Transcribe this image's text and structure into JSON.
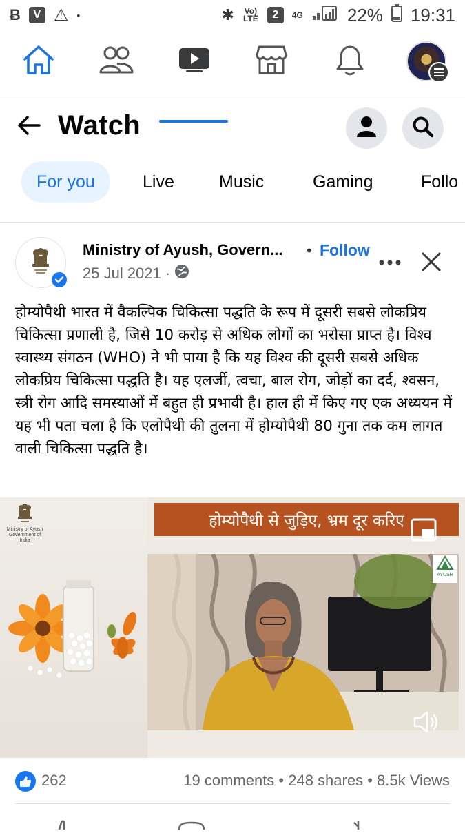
{
  "status_bar": {
    "network_label": "Vo) LTE",
    "sim_label": "2",
    "data_label": "4G",
    "battery": "22%",
    "time": "19:31"
  },
  "nav": {
    "items": [
      "home-icon",
      "friends-icon",
      "watch-icon",
      "marketplace-icon",
      "notifications-icon",
      "profile-menu"
    ],
    "active": "watch-icon"
  },
  "header": {
    "title": "Watch"
  },
  "tabs": [
    {
      "label": "For you",
      "active": true
    },
    {
      "label": "Live"
    },
    {
      "label": "Music"
    },
    {
      "label": "Gaming"
    },
    {
      "label": "Follo"
    }
  ],
  "post": {
    "page_name": "Ministry of Ayush, Govern...",
    "follow_label": "Follow",
    "date": "25 Jul 2021 ·",
    "body": "होम्योपैथी भारत में वैकल्पिक चिकित्सा पद्धति के रूप में दूसरी सबसे लोकप्रिय चिकित्सा प्रणाली है, जिसे 10 करोड़ से अधिक लोगों का भरोसा प्राप्त है। विश्व स्वास्थ्य संगठन (WHO) ने भी पाया है कि यह विश्व की दूसरी सबसे अधिक लोकप्रिय चिकित्सा पद्धति है। यह एलर्जी, त्वचा, बाल रोग, जोड़ों का दर्द, श्वसन, स्त्री रोग आदि समस्याओं में बहुत ही प्रभावी है। हाल ही में किए गए एक अध्ययन में यह भी पता चला है कि एलोपैथी की तुलना में होम्योपैथी 80 गुना तक कम लागत वाली चिकित्सा पद्धति है।",
    "video": {
      "banner_text": "होम्योपैथी से जुड़िए, भ्रम दूर करिए",
      "logo_text_line1": "Ministry of Ayush",
      "logo_text_line2": "Government of India",
      "ayush_logo_text": "AYUSH"
    },
    "stats": {
      "likes": "262",
      "comments_shares_views": "19 comments • 248 shares • 8.5k Views"
    }
  },
  "colors": {
    "accent": "#1b74e4",
    "tab_active_bg": "#e7f3ff",
    "banner": "#b5521f",
    "muted_text": "#65676b"
  }
}
